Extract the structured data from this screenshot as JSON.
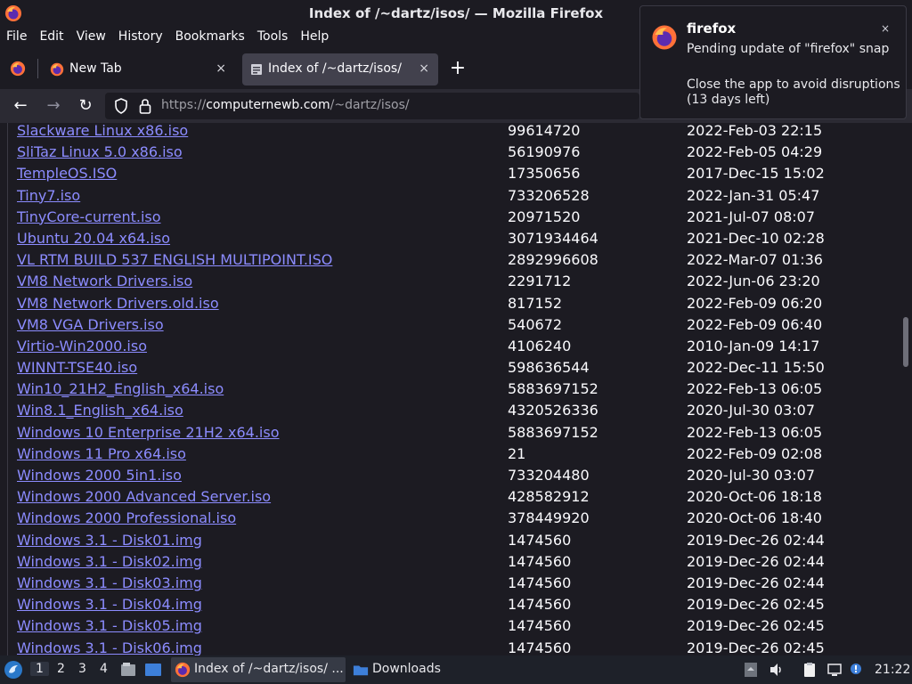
{
  "window": {
    "title": "Index of /~dartz/isos/ — Mozilla Firefox"
  },
  "menubar": {
    "items": [
      "File",
      "Edit",
      "View",
      "History",
      "Bookmarks",
      "Tools",
      "Help"
    ]
  },
  "tabs": [
    {
      "label": "New Tab",
      "close": "×",
      "active": false
    },
    {
      "label": "Index of /~dartz/isos/",
      "close": "×",
      "active": true
    }
  ],
  "new_tab": "+",
  "navbar": {
    "back": "←",
    "forward": "→",
    "reload": "↻",
    "url_prefix": "https://",
    "url_host": "computernewb.com",
    "url_path": "/~dartz/isos/"
  },
  "notification": {
    "app": "firefox",
    "body1": "Pending update of \"firefox\" snap",
    "body2": "Close the app to avoid disruptions (13 days left)",
    "close": "×"
  },
  "listing": [
    {
      "name": "Slackware Linux x86.iso",
      "size": "99614720",
      "date": "2022-Feb-03 22:15"
    },
    {
      "name": "SliTaz Linux 5.0 x86.iso",
      "size": "56190976",
      "date": "2022-Feb-05 04:29"
    },
    {
      "name": "TempleOS.ISO",
      "size": "17350656",
      "date": "2017-Dec-15 15:02"
    },
    {
      "name": "Tiny7.iso",
      "size": "733206528",
      "date": "2022-Jan-31 05:47"
    },
    {
      "name": "TinyCore-current.iso",
      "size": "20971520",
      "date": "2021-Jul-07 08:07"
    },
    {
      "name": "Ubuntu 20.04 x64.iso",
      "size": "3071934464",
      "date": "2021-Dec-10 02:28"
    },
    {
      "name": "VL RTM BUILD 537 ENGLISH MULTIPOINT.ISO",
      "size": "2892996608",
      "date": "2022-Mar-07 01:36"
    },
    {
      "name": "VM8 Network Drivers.iso",
      "size": "2291712",
      "date": "2022-Jun-06 23:20"
    },
    {
      "name": "VM8 Network Drivers.old.iso",
      "size": "817152",
      "date": "2022-Feb-09 06:20"
    },
    {
      "name": "VM8 VGA Drivers.iso",
      "size": "540672",
      "date": "2022-Feb-09 06:40"
    },
    {
      "name": "Virtio-Win2000.iso",
      "size": "4106240",
      "date": "2010-Jan-09 14:17"
    },
    {
      "name": "WINNT-TSE40.iso",
      "size": "598636544",
      "date": "2022-Dec-11 15:50"
    },
    {
      "name": "Win10_21H2_English_x64.iso",
      "size": "5883697152",
      "date": "2022-Feb-13 06:05"
    },
    {
      "name": "Win8.1_English_x64.iso",
      "size": "4320526336",
      "date": "2020-Jul-30 03:07"
    },
    {
      "name": "Windows 10 Enterprise 21H2 x64.iso",
      "size": "5883697152",
      "date": "2022-Feb-13 06:05"
    },
    {
      "name": "Windows 11 Pro x64.iso",
      "size": "21",
      "date": "2022-Feb-09 02:08"
    },
    {
      "name": "Windows 2000 5in1.iso",
      "size": "733204480",
      "date": "2020-Jul-30 03:07"
    },
    {
      "name": "Windows 2000 Advanced Server.iso",
      "size": "428582912",
      "date": "2020-Oct-06 18:18"
    },
    {
      "name": "Windows 2000 Professional.iso",
      "size": "378449920",
      "date": "2020-Oct-06 18:40"
    },
    {
      "name": "Windows 3.1 - Disk01.img",
      "size": "1474560",
      "date": "2019-Dec-26 02:44"
    },
    {
      "name": "Windows 3.1 - Disk02.img",
      "size": "1474560",
      "date": "2019-Dec-26 02:44"
    },
    {
      "name": "Windows 3.1 - Disk03.img",
      "size": "1474560",
      "date": "2019-Dec-26 02:44"
    },
    {
      "name": "Windows 3.1 - Disk04.img",
      "size": "1474560",
      "date": "2019-Dec-26 02:45"
    },
    {
      "name": "Windows 3.1 - Disk05.img",
      "size": "1474560",
      "date": "2019-Dec-26 02:45"
    },
    {
      "name": "Windows 3.1 - Disk06.img",
      "size": "1474560",
      "date": "2019-Dec-26 02:45"
    }
  ],
  "taskbar": {
    "workspaces": [
      "1",
      "2",
      "3",
      "4"
    ],
    "tasks": [
      {
        "label": "Index of /~dartz/isos/ ...",
        "icon": "firefox-icon",
        "active": true
      },
      {
        "label": "Downloads",
        "icon": "folder-icon",
        "active": false
      }
    ],
    "clock": "21:22"
  },
  "colors": {
    "link": "#8c8cff",
    "background": "#1c1b22",
    "toolbar": "#2b2a33"
  }
}
